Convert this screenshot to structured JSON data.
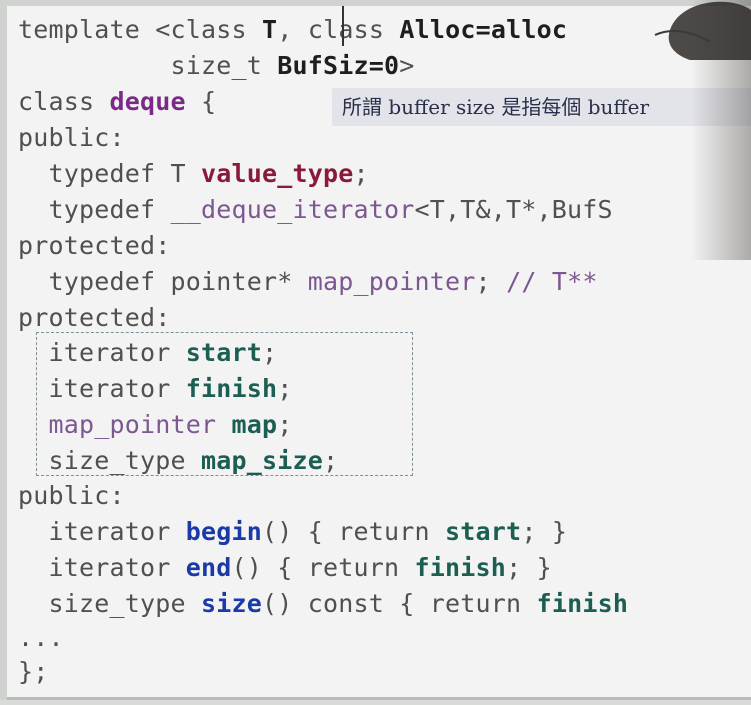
{
  "code": {
    "line1": {
      "a": "template <class ",
      "b": "T",
      "c": ", ",
      "d": "class ",
      "e": "Alloc=alloc"
    },
    "line2": {
      "a": "          size_t ",
      "b": "BufSiz=0",
      "c": ">"
    },
    "line3": {
      "a": "class ",
      "b": "deque",
      "c": " {"
    },
    "line4": "public:",
    "line5": {
      "a": "  typedef T ",
      "b": "value_type",
      "c": ";"
    },
    "line6": {
      "a": "  typedef ",
      "b": "__deque_iterator",
      "c": "<T,T&,T*,BufS"
    },
    "line7": "protected:",
    "line8": {
      "a": "  typedef pointer* ",
      "b": "map_pointer",
      "c": "; ",
      "d": "// T**"
    },
    "line9": "protected:",
    "line10": {
      "a": "  iterator ",
      "b": "start",
      "c": ";"
    },
    "line11": {
      "a": "  iterator ",
      "b": "finish",
      "c": ";"
    },
    "line12": {
      "a": "  map_pointer ",
      "b": "map",
      "c": ";"
    },
    "line13": {
      "a": "  size_type ",
      "b": "map_size",
      "c": ";"
    },
    "line14": "public:",
    "line15": {
      "a": "  iterator ",
      "b": "begin",
      "c": "() { return ",
      "d": "start",
      "e": "; }"
    },
    "line16": {
      "a": "  iterator ",
      "b": "end",
      "c": "() { return ",
      "d": "finish",
      "e": "; }"
    },
    "line17": {
      "a": "  size_type ",
      "b": "size",
      "c": "() const { return ",
      "d": "finish"
    },
    "line18": "...",
    "line19": "};"
  },
  "caption": "所謂 buffer size 是指每個 buffer",
  "colors": {
    "keyword": "#505050",
    "function": "#1a3aa8",
    "member": "#1d5e53",
    "type_name": "#7b2a88",
    "value": "#8a1a3a"
  }
}
